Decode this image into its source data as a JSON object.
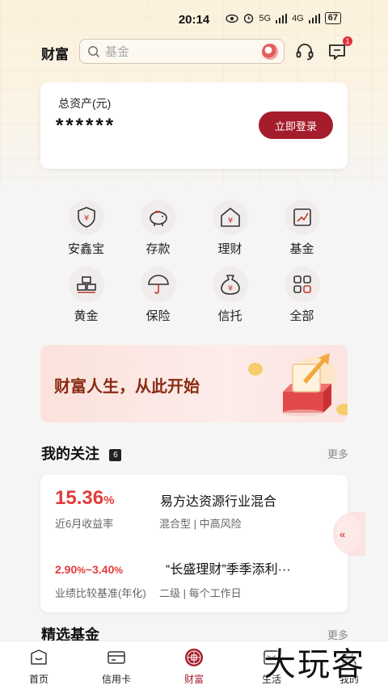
{
  "status_bar": {
    "time": "20:14",
    "signal1": "5G",
    "signal2": "4G",
    "battery": "67"
  },
  "header": {
    "title": "财富",
    "search_placeholder": "基金",
    "message_badge": "1"
  },
  "assets": {
    "label": "总资产(元)",
    "value": "******",
    "login_label": "立即登录"
  },
  "grid": [
    {
      "label": "安鑫宝",
      "icon": "shield-yen-icon"
    },
    {
      "label": "存款",
      "icon": "piggy-bank-icon"
    },
    {
      "label": "理财",
      "icon": "house-yen-icon"
    },
    {
      "label": "基金",
      "icon": "chart-trend-icon"
    },
    {
      "label": "黄金",
      "icon": "gold-bars-icon"
    },
    {
      "label": "保险",
      "icon": "umbrella-icon"
    },
    {
      "label": "信托",
      "icon": "money-bag-icon"
    },
    {
      "label": "全部",
      "icon": "grid-all-icon"
    }
  ],
  "banner": {
    "text": "财富人生，从此开始"
  },
  "follow": {
    "title": "我的关注",
    "count": "6",
    "more": "更多",
    "items": [
      {
        "rate": "15.36",
        "rate_unit": "%",
        "rate_label": "近6月收益率",
        "name": "易方达资源行业混合",
        "tags": "混合型 | 中高风险"
      },
      {
        "rate_low": "2.90",
        "rate_low_unit": "%",
        "separator": "~",
        "rate_high": "3.40",
        "rate_high_unit": "%",
        "rate_label": "业绩比较基准(年化)",
        "name": "“长盛理财”季季添利···",
        "tags": "二级 | 每个工作日"
      }
    ]
  },
  "featured": {
    "title": "精选基金",
    "more": "更多"
  },
  "float_tab": {
    "label": "«"
  },
  "tabbar": [
    {
      "label": "首页",
      "icon": "home-icon",
      "active": false
    },
    {
      "label": "信用卡",
      "icon": "credit-card-icon",
      "active": false
    },
    {
      "label": "财富",
      "icon": "wealth-emblem-icon",
      "active": true
    },
    {
      "label": "生活",
      "icon": "life-icon",
      "active": false
    },
    {
      "label": "我的",
      "icon": "profile-icon",
      "active": false
    }
  ],
  "watermark": "大玩客",
  "colors": {
    "accent": "#a51c2c",
    "rate_red": "#e23b3b",
    "banner_text": "#8a2b14"
  }
}
